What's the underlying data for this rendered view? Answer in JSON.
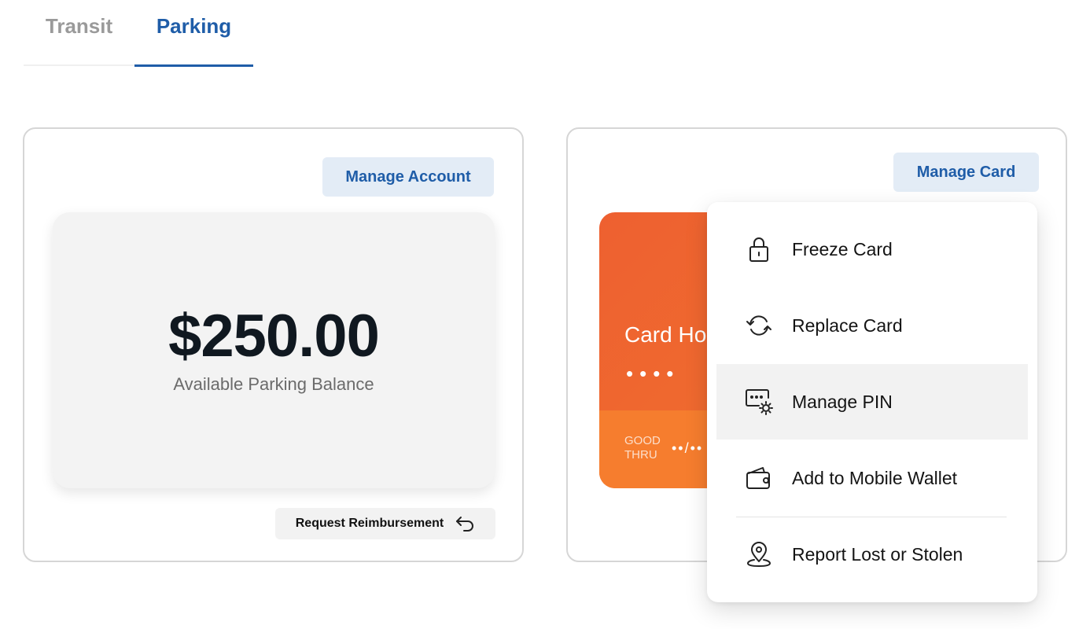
{
  "tabs": [
    {
      "label": "Transit",
      "active": false
    },
    {
      "label": "Parking",
      "active": true
    }
  ],
  "account_panel": {
    "manage_button": "Manage Account",
    "balance": "$250.00",
    "balance_label": "Available Parking Balance",
    "reimburse_button": "Request Reimbursement",
    "reimburse_icon": "return-arrow-icon"
  },
  "card_panel": {
    "manage_button": "Manage Card",
    "card": {
      "holder_text": "Card Ho",
      "number_mask": "••••",
      "good_thru_label": "GOOD THRU",
      "good_thru_value": "••/••"
    }
  },
  "manage_card_menu": {
    "items": [
      {
        "label": "Freeze Card",
        "icon": "lock-icon"
      },
      {
        "label": "Replace Card",
        "icon": "refresh-icon"
      },
      {
        "label": "Manage PIN",
        "icon": "pin-settings-icon",
        "highlighted": true
      },
      {
        "label": "Add to Mobile Wallet",
        "icon": "wallet-icon"
      },
      {
        "label": "Report Lost or Stolen",
        "icon": "location-pin-icon"
      }
    ]
  },
  "colors": {
    "accent": "#1f5da8",
    "card_orange": "#ee6030",
    "button_bg": "#e3ecf6"
  }
}
